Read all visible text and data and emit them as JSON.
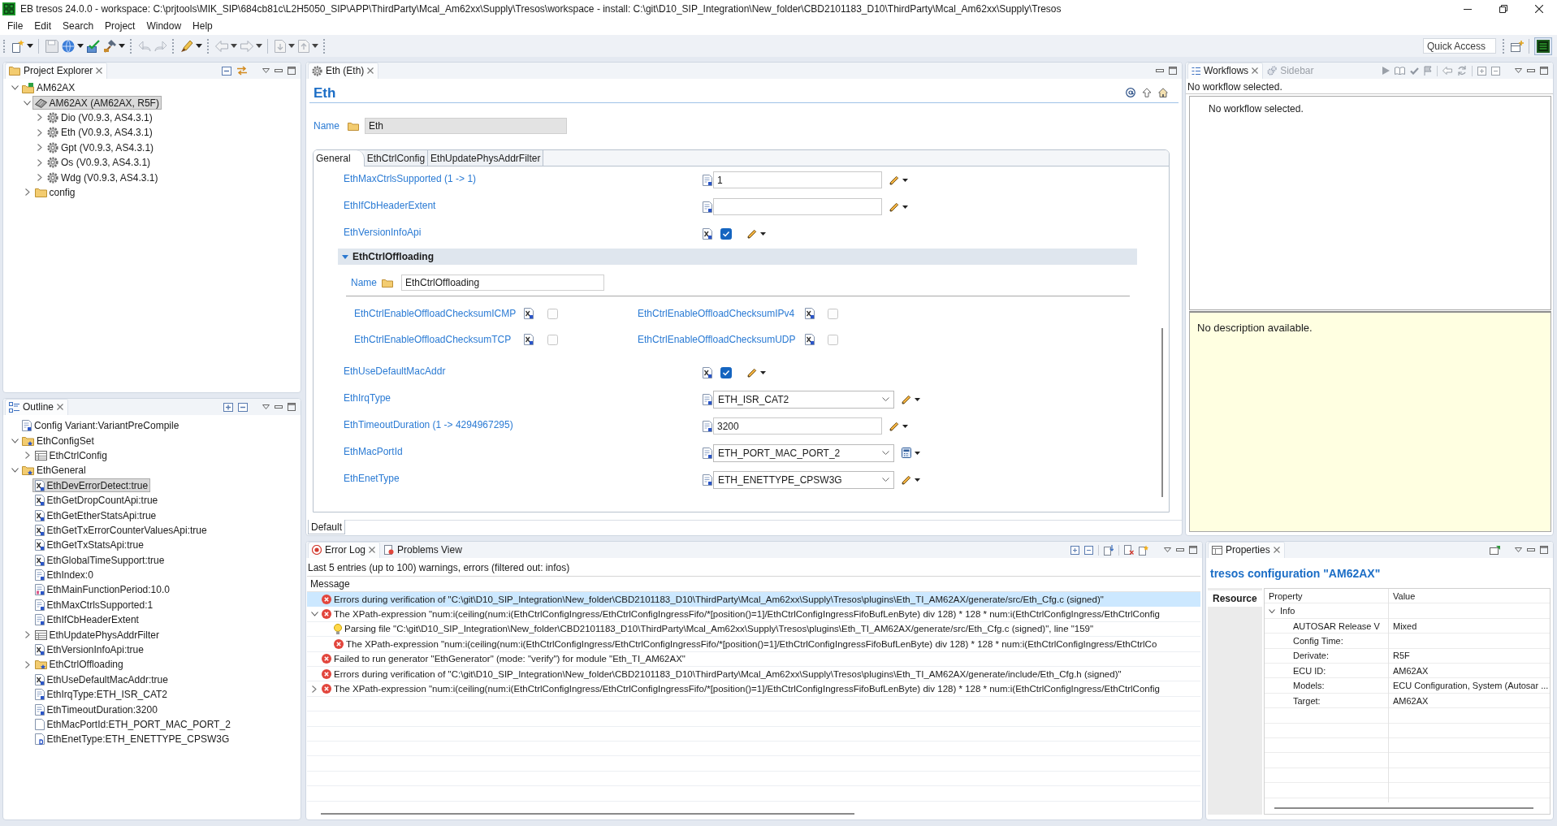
{
  "window": {
    "title": "EB tresos 24.0.0 - workspace: C:\\prjtools\\MIK_SIP\\684cb81c\\L2H5050_SIP\\APP\\ThirdParty\\Mcal_Am62xx\\Supply\\Tresos\\workspace - install: C:\\git\\D10_SIP_Integration\\New_folder\\CBD2101183_D10\\ThirdParty\\Mcal_Am62xx\\Supply\\Tresos"
  },
  "menu": [
    "File",
    "Edit",
    "Search",
    "Project",
    "Window",
    "Help"
  ],
  "toolbar": {
    "quick_access": {
      "placeholder": "Quick Access"
    }
  },
  "project_explorer": {
    "title": "Project Explorer",
    "tree": [
      {
        "label": "AM62AX",
        "kind": "project",
        "expanded": true,
        "selected": false,
        "children": [
          {
            "label": "AM62AX (AM62AX, R5F)",
            "kind": "ecu",
            "expanded": true,
            "selected": true,
            "children": [
              {
                "label": "Dio (V0.9.3, AS4.3.1)",
                "kind": "module",
                "expanded": false,
                "selected": false
              },
              {
                "label": "Eth (V0.9.3, AS4.3.1)",
                "kind": "module",
                "expanded": false,
                "selected": false
              },
              {
                "label": "Gpt (V0.9.3, AS4.3.1)",
                "kind": "module",
                "expanded": false,
                "selected": false
              },
              {
                "label": "Os (V0.9.3, AS4.3.1)",
                "kind": "module",
                "expanded": false,
                "selected": false
              },
              {
                "label": "Wdg (V0.9.3, AS4.3.1)",
                "kind": "module",
                "expanded": false,
                "selected": false
              }
            ]
          },
          {
            "label": "config",
            "kind": "folder",
            "expanded": false,
            "selected": false
          }
        ]
      }
    ]
  },
  "outline": {
    "title": "Outline",
    "tree": [
      {
        "label": "Config Variant:VariantPreCompile",
        "kind": "variant",
        "selected": false
      },
      {
        "label": "EthConfigSet",
        "kind": "container",
        "expanded": true,
        "selected": false,
        "children": [
          {
            "label": "EthCtrlConfig",
            "kind": "table",
            "expanded": false,
            "selected": false
          }
        ]
      },
      {
        "label": "EthGeneral",
        "kind": "container",
        "expanded": true,
        "selected": false,
        "children": [
          {
            "label": "EthDevErrorDetect:true",
            "kind": "boolean",
            "selected": true
          },
          {
            "label": "EthGetDropCountApi:true",
            "kind": "boolean",
            "selected": false
          },
          {
            "label": "EthGetEtherStatsApi:true",
            "kind": "boolean",
            "selected": false
          },
          {
            "label": "EthGetTxErrorCounterValuesApi:true",
            "kind": "boolean",
            "selected": false
          },
          {
            "label": "EthGetTxStatsApi:true",
            "kind": "boolean",
            "selected": false
          },
          {
            "label": "EthGlobalTimeSupport:true",
            "kind": "boolean",
            "selected": false
          },
          {
            "label": "EthIndex:0",
            "kind": "integer",
            "selected": false
          },
          {
            "label": "EthMainFunctionPeriod:10.0",
            "kind": "float",
            "selected": false
          },
          {
            "label": "EthMaxCtrlsSupported:1",
            "kind": "integer",
            "selected": false
          },
          {
            "label": "EthIfCbHeaderExtent",
            "kind": "enum",
            "selected": false
          },
          {
            "label": "EthUpdatePhysAddrFilter",
            "kind": "table",
            "expanded": false,
            "selected": false
          },
          {
            "label": "EthVersionInfoApi:true",
            "kind": "boolean",
            "selected": false
          },
          {
            "label": "EthCtrlOffloading",
            "kind": "container",
            "expanded": false,
            "selected": false
          },
          {
            "label": "EthUseDefaultMacAddr:true",
            "kind": "boolean",
            "selected": false
          },
          {
            "label": "EthIrqType:ETH_ISR_CAT2",
            "kind": "enum",
            "selected": false
          },
          {
            "label": "EthTimeoutDuration:3200",
            "kind": "integer",
            "selected": false
          },
          {
            "label": "EthMacPortId:ETH_PORT_MAC_PORT_2",
            "kind": "plain",
            "selected": false
          },
          {
            "label": "EthEnetType:ETH_ENETTYPE_CPSW3G",
            "kind": "derived",
            "selected": false
          }
        ]
      }
    ]
  },
  "editor": {
    "tab": "Eth (Eth)",
    "heading": "Eth",
    "name": {
      "label": "Name",
      "value": "Eth"
    },
    "tabs": [
      {
        "label": "General",
        "selected": true
      },
      {
        "label": "EthCtrlConfig",
        "selected": false
      },
      {
        "label": "EthUpdatePhysAddrFilter",
        "selected": false
      }
    ],
    "params": [
      {
        "kind": "text",
        "label": "EthMaxCtrlsSupported (1 -> 1)",
        "value": "1",
        "calculated": false
      },
      {
        "kind": "text",
        "label": "EthIfCbHeaderExtent",
        "calculated": false
      },
      {
        "kind": "checkbox",
        "label": "EthVersionInfoApi",
        "checked": true,
        "calculated": false
      },
      {
        "kind": "group",
        "label": "EthCtrlOffloading",
        "expanded": true,
        "name": {
          "label": "Name",
          "value": "EthCtrlOffloading"
        },
        "options": [
          {
            "label": "EthCtrlEnableOffloadChecksumICMP",
            "checked": false
          },
          {
            "label": "EthCtrlEnableOffloadChecksumIPv4",
            "checked": false
          },
          {
            "label": "EthCtrlEnableOffloadChecksumTCP",
            "checked": false
          },
          {
            "label": "EthCtrlEnableOffloadChecksumUDP",
            "checked": false
          }
        ]
      },
      {
        "kind": "checkbox",
        "label": "EthUseDefaultMacAddr",
        "checked": true,
        "calculated": false
      },
      {
        "kind": "combo",
        "label": "EthIrqType",
        "value": "ETH_ISR_CAT2",
        "calculated": false
      },
      {
        "kind": "text",
        "label": "EthTimeoutDuration (1 -> 4294967295)",
        "value": "3200",
        "calculated": false
      },
      {
        "kind": "combo",
        "label": "EthMacPortId",
        "value": "ETH_PORT_MAC_PORT_2",
        "calculated": true
      },
      {
        "kind": "combo",
        "label": "EthEnetType",
        "value": "ETH_ENETTYPE_CPSW3G",
        "calculated": false
      }
    ],
    "bottom_tabs": [
      {
        "label": "Default",
        "selected": true
      }
    ]
  },
  "workflows": {
    "tabs": [
      {
        "label": "Workflows",
        "selected": true
      },
      {
        "label": "Sidebar",
        "selected": false
      }
    ],
    "status": "No workflow selected.",
    "list_message": "No workflow selected.",
    "description": "No description available."
  },
  "error_log": {
    "tabs": [
      {
        "label": "Error Log",
        "selected": true
      },
      {
        "label": "Problems View",
        "selected": false
      }
    ],
    "summary": "Last 5 entries (up to 100) warnings, errors (filtered out: infos)",
    "column": "Message",
    "entries": [
      {
        "kind": "error",
        "message": "Errors during verification of \"C:\\git\\D10_SIP_Integration\\New_folder\\CBD2101183_D10\\ThirdParty\\Mcal_Am62xx\\Supply\\Tresos\\plugins\\Eth_TI_AM62AX/generate/src/Eth_Cfg.c (signed)\"",
        "selected": true
      },
      {
        "kind": "error",
        "message": "The XPath-expression \"num:i(ceiling(num:i(EthCtrlConfigIngress/EthCtrlConfigIngressFifo/*[position()=1]/EthCtrlConfigIngressFifoBufLenByte) div 128) * 128 * num:i(EthCtrlConfigIngress/EthCtrlConfig",
        "selected": false,
        "expanded": true,
        "children": [
          {
            "kind": "info",
            "message": "Parsing file \"C:\\git\\D10_SIP_Integration\\New_folder\\CBD2101183_D10\\ThirdParty\\Mcal_Am62xx\\Supply\\Tresos\\plugins\\Eth_TI_AM62AX/generate/src/Eth_Cfg.c (signed)\", line \"159\"",
            "selected": false
          },
          {
            "kind": "error",
            "message": "The XPath-expression \"num:i(ceiling(num:i(EthCtrlConfigIngress/EthCtrlConfigIngressFifo/*[position()=1]/EthCtrlConfigIngressFifoBufLenByte) div 128) * 128 * num:i(EthCtrlConfigIngress/EthCtrlCo",
            "selected": false
          }
        ]
      },
      {
        "kind": "error",
        "message": "Failed to run generator \"EthGenerator\" (mode: \"verify\") for module \"Eth_TI_AM62AX\"",
        "selected": false
      },
      {
        "kind": "error",
        "message": "Errors during verification of \"C:\\git\\D10_SIP_Integration\\New_folder\\CBD2101183_D10\\ThirdParty\\Mcal_Am62xx\\Supply\\Tresos\\plugins\\Eth_TI_AM62AX/generate/include/Eth_Cfg.h (signed)\"",
        "selected": false
      },
      {
        "kind": "error",
        "message": "The XPath-expression \"num:i(ceiling(num:i(EthCtrlConfigIngress/EthCtrlConfigIngressFifo/*[position()=1]/EthCtrlConfigIngressFifoBufLenByte) div 128) * 128 * num:i(EthCtrlConfigIngress/EthCtrlConfig",
        "selected": false,
        "expanded": false
      }
    ]
  },
  "properties": {
    "title": "Properties",
    "heading": "tresos configuration \"AM62AX\"",
    "side_tabs": [
      {
        "label": "Resource",
        "selected": true
      }
    ],
    "columns": [
      "Property",
      "Value"
    ],
    "rows": [
      {
        "property": "Info",
        "expanded": true,
        "children": [
          {
            "property": "AUTOSAR Release V",
            "value": "Mixed"
          },
          {
            "property": "Config Time:"
          },
          {
            "property": "Derivate:",
            "value": "R5F"
          },
          {
            "property": "ECU ID:",
            "value": "AM62AX"
          },
          {
            "property": "Models:",
            "value": "ECU Configuration, System (Autosar ..."
          },
          {
            "property": "Target:",
            "value": "AM62AX"
          }
        ]
      }
    ]
  }
}
